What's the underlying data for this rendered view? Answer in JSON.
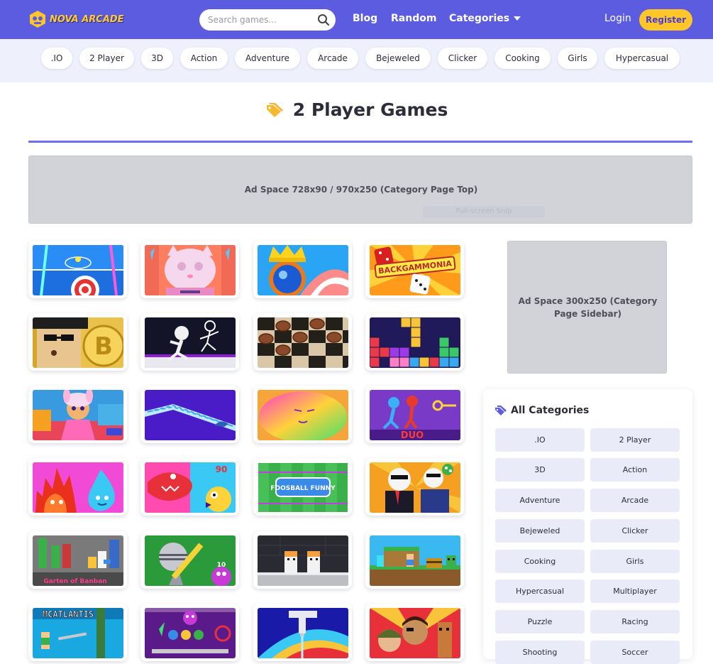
{
  "header": {
    "logo_text": "NOVA ARCADE",
    "search_placeholder": "Search games...",
    "nav": {
      "blog": "Blog",
      "random": "Random",
      "categories": "Categories"
    },
    "login": "Login",
    "register": "Register",
    "colors": {
      "bar": "#5b5ce0",
      "accent": "#ffc62a"
    }
  },
  "category_strip": [
    ".IO",
    "2 Player",
    "3D",
    "Action",
    "Adventure",
    "Arcade",
    "Bejeweled",
    "Clicker",
    "Cooking",
    "Girls",
    "Hypercasual"
  ],
  "page": {
    "title": "2 Player Games",
    "ad_top": "Ad Space 728x90 / 970x250 (Category Page Top)",
    "ad_overlay": "Full-screen Snip"
  },
  "games": [
    {
      "title": "",
      "icon": "air-hockey-thumbnail"
    },
    {
      "title": "",
      "icon": "cat-makeover-thumbnail"
    },
    {
      "title": "",
      "icon": "crown-ball-thumbnail"
    },
    {
      "title": "",
      "icon": "backgammonia-thumbnail",
      "text": "BACKGAMMONIA"
    },
    {
      "title": "",
      "icon": "bitcoin-guy-thumbnail"
    },
    {
      "title": "",
      "icon": "stickman-run-thumbnail"
    },
    {
      "title": "",
      "icon": "checkers-thumbnail"
    },
    {
      "title": "",
      "icon": "block-puzzle-thumbnail"
    },
    {
      "title": "",
      "icon": "doll-room-thumbnail"
    },
    {
      "title": "",
      "icon": "shark-ramp-thumbnail"
    },
    {
      "title": "",
      "icon": "rainbow-blob-thumbnail"
    },
    {
      "title": "",
      "icon": "fire-water-stick-thumbnail",
      "text": "DUO"
    },
    {
      "title": "",
      "icon": "fire-water-thumbnail"
    },
    {
      "title": "",
      "icon": "fish-battle-thumbnail",
      "text": "90"
    },
    {
      "title": "",
      "icon": "foosball-funny-thumbnail",
      "text": "FOOSBALL FUNNY"
    },
    {
      "title": "",
      "icon": "dab-friends-thumbnail"
    },
    {
      "title": "",
      "icon": "garten-of-banban-thumbnail",
      "text": "Garten of Banban"
    },
    {
      "title": "",
      "icon": "knight-sword-thumbnail",
      "text": "10"
    },
    {
      "title": "",
      "icon": "twin-ghosts-thumbnail"
    },
    {
      "title": "",
      "icon": "pixel-treasure-thumbnail"
    },
    {
      "title": "",
      "icon": "mcatlantis-thumbnail",
      "text": "MCATLANTIS"
    },
    {
      "title": "",
      "icon": "monster-factory-thumbnail"
    },
    {
      "title": "",
      "icon": "water-tap-thumbnail"
    },
    {
      "title": "",
      "icon": "army-heroes-thumbnail"
    }
  ],
  "sidebar": {
    "ad_side": "Ad Space 300x250 (Category Page Sidebar)",
    "all_categories_title": "All Categories",
    "categories": [
      ".IO",
      "2 Player",
      "3D",
      "Action",
      "Adventure",
      "Arcade",
      "Bejeweled",
      "Clicker",
      "Cooking",
      "Girls",
      "Hypercasual",
      "Multiplayer",
      "Puzzle",
      "Racing",
      "Shooting",
      "Soccer"
    ]
  }
}
